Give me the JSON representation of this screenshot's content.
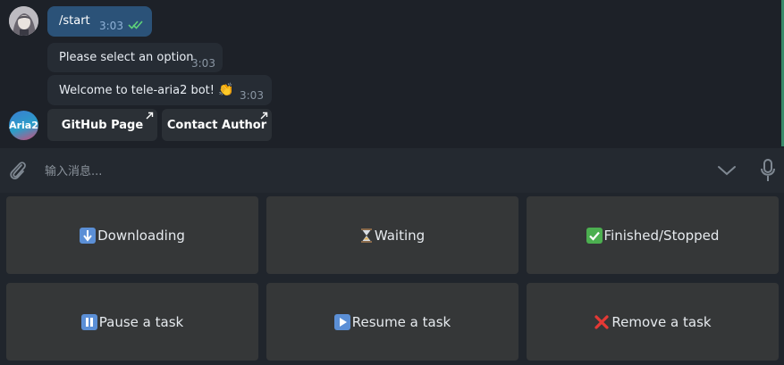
{
  "messages": {
    "outgoing": {
      "text": "/start",
      "time": "3:03"
    },
    "incoming": [
      {
        "text": "Please select an option",
        "time": "3:03"
      },
      {
        "text": "Welcome to tele-aria2 bot!",
        "emoji": "👏",
        "time": "3:03"
      }
    ]
  },
  "bot": {
    "avatar_label": "Aria2"
  },
  "inline_buttons": [
    {
      "label": "GitHub Page"
    },
    {
      "label": "Contact Author"
    }
  ],
  "composer": {
    "placeholder": "输入消息..."
  },
  "keyboard": [
    {
      "label": "Downloading",
      "icon": "down-arrow-emoji"
    },
    {
      "label": "Waiting",
      "icon": "hourglass-emoji"
    },
    {
      "label": "Finished/Stopped",
      "icon": "check-mark-emoji"
    },
    {
      "label": "Pause a task",
      "icon": "pause-emoji"
    },
    {
      "label": "Resume a task",
      "icon": "play-emoji"
    },
    {
      "label": "Remove a task",
      "icon": "cross-mark-emoji"
    }
  ],
  "colors": {
    "chat_bg": "#1d2128",
    "outgoing_bubble": "#2b5278",
    "incoming_bubble": "#262c34",
    "keyboard_button": "#353738",
    "read_ticks": "#5fd37a"
  }
}
